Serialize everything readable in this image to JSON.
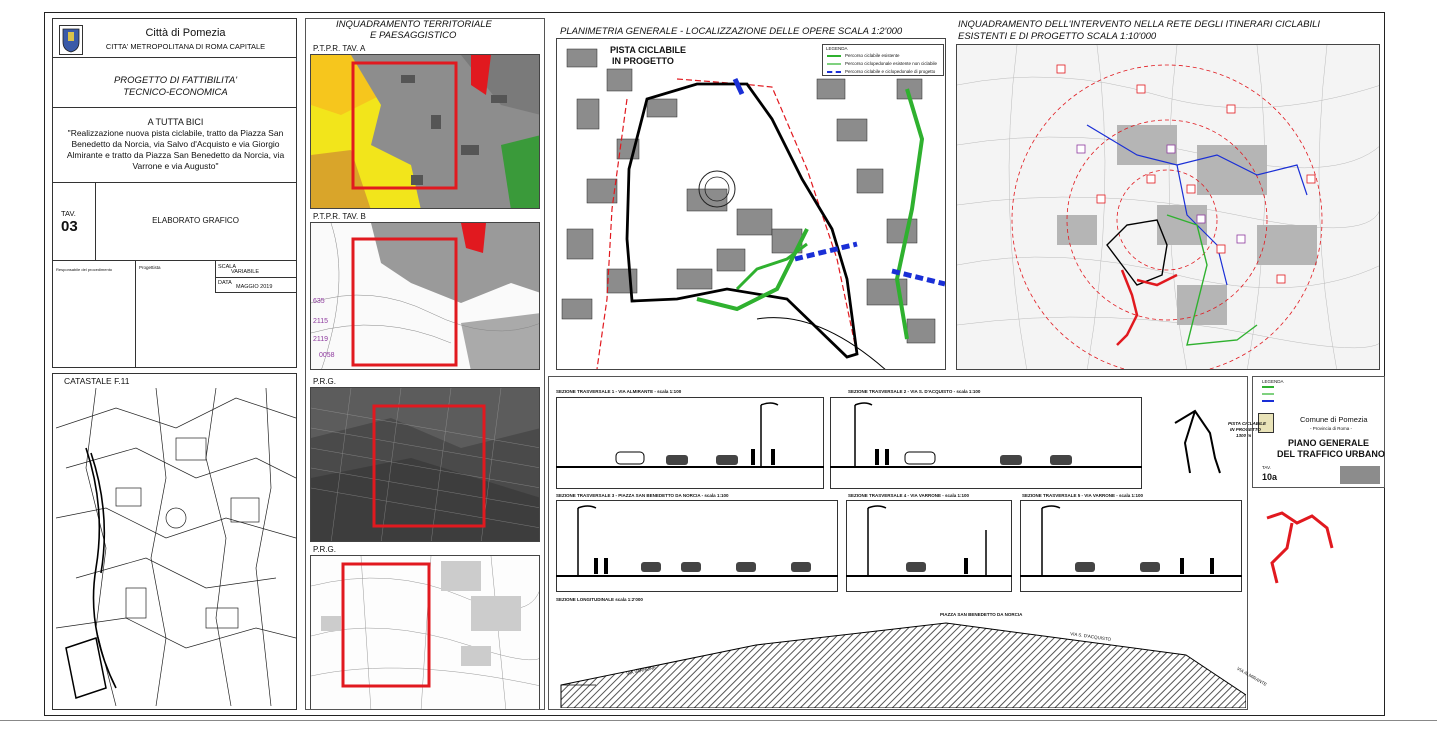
{
  "titleblock": {
    "city": "Città di Pomezia",
    "metro": "CITTA' METROPOLITANA DI ROMA CAPITALE",
    "project_type_1": "PROGETTO DI FATTIBILITA'",
    "project_type_2": "TECNICO-ECONOMICA",
    "project_name": "A TUTTA BICI",
    "project_desc": "\"Realizzazione nuova pista ciclabile, tratto da Piazza San Benedetto da Norcia, via Salvo d'Acquisto e via Giorgio Almirante e tratto da Piazza San Benedetto da Norcia, via Varrone e via Augusto\"",
    "tav_label": "TAV.",
    "tav_num": "03",
    "elaborato": "ELABORATO GRAFICO",
    "scala_label": "SCALA",
    "scala_value": "VARIABILE",
    "data_label": "DATA",
    "data_value": "MAGGIO 2019",
    "progettista_label": "Progettista",
    "rup_label": "Responsabile del procedimento"
  },
  "panels": {
    "territoriale_1": "INQUADRAMENTO TERRITORIALE",
    "territoriale_2": "E PAESAGGISTICO",
    "ptpr_a": "P.T.P.R. TAV. A",
    "ptpr_b": "P.T.P.R. TAV. B",
    "prg1": "P.R.G.",
    "prg2": "P.R.G.",
    "catastale": "CATASTALE F.11",
    "planimetria": "PLANIMETRIA GENERALE - LOCALIZZAZIONE DELLE OPERE scala 1:2'000",
    "rete_1": "INQUADRAMENTO DELL'INTERVENTO NELLA RETE DEGLI ITINERARI CICLABILI",
    "rete_2": "ESISTENTI E DI PROGETTO scala 1:10'000"
  },
  "plan": {
    "pista_label_1": "PISTA CICLABILE",
    "pista_label_2": "IN PROGETTO",
    "legenda": "LEGENDA",
    "legend_items": [
      "Percorso ciclabile esistente",
      "Percorso ciclopedonale esistente non ciclabile",
      "Percorso ciclabile e ciclopedonale di progetto"
    ]
  },
  "pgtu": {
    "legenda": "LEGENDA",
    "comune": "Comune di Pomezia",
    "provincia": "- Provincia di Roma -",
    "title_1": "PIANO GENERALE",
    "title_2": "DEL TRAFFICO URBANO",
    "tav": "TAV.",
    "tav_num": "10a",
    "pista_1": "PISTA CICLABILE",
    "pista_2": "IN PROGETTO",
    "pista_3": "1300 m"
  },
  "sections": {
    "s1": "SEZIONE TRASVERSALE 1 - VIA ALMIRANTE - scala 1:100",
    "s2": "SEZIONE TRASVERSALE 2 - VIA S. D'ACQUISTO - scala 1:100",
    "s3": "SEZIONE TRASVERSALE 3 - PIAZZA SAN BENEDETTO DA NORCIA - scala 1:100",
    "s4": "SEZIONE TRASVERSALE 4 - VIA VARRONE - scala 1:100",
    "s5": "SEZIONE TRASVERSALE 5 - VIA VARRONE - scala 1:100",
    "long": "SEZIONE LONGITUDINALE scala 1:2'000",
    "piazza": "PIAZZA SAN BENEDETTO DA NORCIA",
    "via_varrone": "VIA VARRONE",
    "via_sdacquisto": "VIA S. D'ACQUISTO",
    "via_almirante": "VIA ALMIRANTE"
  },
  "colors": {
    "red": "#e1191f",
    "green": "#2fb12f",
    "blue": "#1a2fd6",
    "yellow": "#f2e51b"
  }
}
